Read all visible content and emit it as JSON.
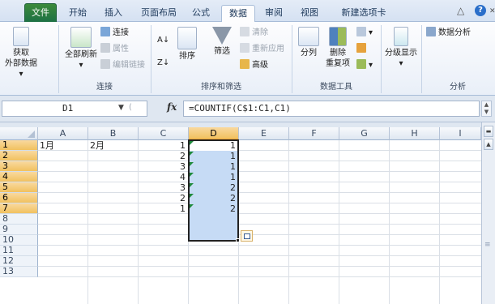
{
  "tabs": [
    {
      "label": "文件",
      "name": "tab-file"
    },
    {
      "label": "开始",
      "name": "tab-home"
    },
    {
      "label": "插入",
      "name": "tab-insert"
    },
    {
      "label": "页面布局",
      "name": "tab-page-layout"
    },
    {
      "label": "公式",
      "name": "tab-formulas"
    },
    {
      "label": "数据",
      "name": "tab-data"
    },
    {
      "label": "审阅",
      "name": "tab-review"
    },
    {
      "label": "视图",
      "name": "tab-view"
    },
    {
      "label": "新建选项卡",
      "name": "tab-new-tab"
    }
  ],
  "ribbon": {
    "get_external": {
      "line1": "获取",
      "line2": "外部数据 ▾"
    },
    "connections": {
      "refresh_all": "全部刷新",
      "connections": "连接",
      "properties": "属性",
      "edit_links": "编辑链接",
      "group": "连接"
    },
    "sort_filter": {
      "sort": "排序",
      "filter": "筛选",
      "clear": "清除",
      "reapply": "重新应用",
      "advanced": "高级",
      "group": "排序和筛选"
    },
    "data_tools": {
      "text_to_columns": "分列",
      "remove_duplicates_1": "删除",
      "remove_duplicates_2": "重复项",
      "group": "数据工具"
    },
    "outline": {
      "label": "分级显示"
    },
    "analysis": {
      "data_analysis": "数据分析",
      "group": "分析"
    }
  },
  "formula_bar": {
    "name_box": "D1",
    "fx": "fx",
    "formula": "=COUNTIF(C$1:C1,C1)"
  },
  "sheet": {
    "columns": [
      "A",
      "B",
      "C",
      "D",
      "E",
      "F",
      "G",
      "H",
      "I"
    ],
    "rows": [
      "1",
      "2",
      "3",
      "4",
      "5",
      "6",
      "7",
      "8",
      "9",
      "10",
      "11",
      "12",
      "13"
    ],
    "selected_column": "D",
    "selected_rows": [
      "1",
      "2",
      "3",
      "4",
      "5",
      "6",
      "7"
    ],
    "A1": "1月",
    "B1": "2月",
    "C": [
      "1",
      "2",
      "3",
      "4",
      "3",
      "2",
      "1"
    ],
    "D": [
      "1",
      "1",
      "1",
      "1",
      "2",
      "2",
      "2"
    ]
  },
  "colors": {
    "file_tab": "#1e7145",
    "selection_fill": "#c6dbf5",
    "header_highlight": "#f1c15f",
    "error_triangle": "#1f8a3c"
  }
}
